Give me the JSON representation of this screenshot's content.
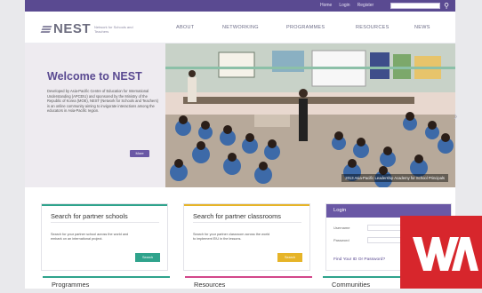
{
  "topbar": {
    "links": [
      "Home",
      "Login",
      "Register"
    ],
    "search": {
      "placeholder": ""
    }
  },
  "header": {
    "logo_text": "NEST",
    "logo_sub": "Network for Schools and Teachers",
    "nav": [
      "ABOUT",
      "NETWORKING",
      "PROGRAMMES",
      "RESOURCES",
      "NEWS"
    ]
  },
  "hero": {
    "title": "Welcome to NEST",
    "description": "Developed by Asia-Pacific Centre of Education for International Understanding (APCEIU) and sponsored by the Ministry of the Republic of Korea (MOE), NEST (Network for Schools and Teachers) is an online community aiming to invigorate interactions among the educators in Asia-Pacific region.",
    "more_label": "More",
    "caption": "2013 Asia-Pacific Leadership Academy for School Principals"
  },
  "cards": [
    {
      "title": "Search for partner schools",
      "description": "Search for your partner school across the world and embark on an international project.",
      "button": "Search",
      "accent": "#2fa38c",
      "button_color": "#2fa38c"
    },
    {
      "title": "Search for partner classrooms",
      "description": "Search for your partner classroom across the world to implement EIU in the lessons.",
      "button": "Search",
      "accent": "#e6b428",
      "button_color": "#e6b428"
    }
  ],
  "login": {
    "title": "Login",
    "username_label": "Username",
    "password_label": "Password",
    "forgot": "Find Your ID Or Password?"
  },
  "sections": [
    {
      "label": "Programmes",
      "accent": "#2fa38c"
    },
    {
      "label": "Resources",
      "accent": "#d2478a"
    },
    {
      "label": "Communities",
      "accent": "#2fa38c"
    }
  ],
  "watermark": {
    "text": "WA"
  }
}
